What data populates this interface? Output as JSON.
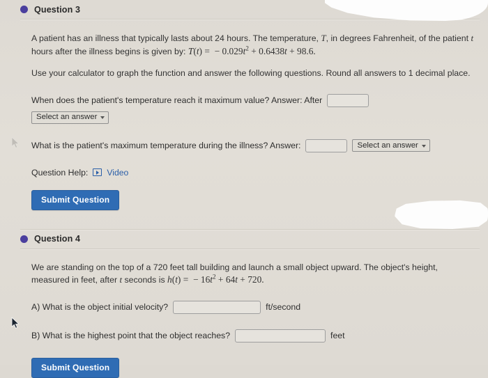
{
  "theme": {
    "page_background": "#dedad3",
    "bullet_color": "#4b3f9e",
    "button_color": "#2f6cb4",
    "link_color": "#2b5fa8"
  },
  "questions": [
    {
      "bullet_icon": "filled-circle-icon",
      "title": "Question 3",
      "paragraphs": [
        {
          "before": "A patient has an illness that typically lasts about 24 hours. The temperature, ",
          "var1": "T",
          "mid": ", in degrees Fahrenheit, of the patient ",
          "var2": "t",
          "after": " hours after the illness begins is given by: ",
          "formula": "T(t) = − 0.029t² + 0.6438t + 98.6."
        },
        {
          "text": "Use your calculator to graph the function and answer the following questions. Round all answers to 1 decimal place."
        }
      ],
      "prompts": [
        {
          "label": "When does the patient's temperature reach it maximum value?  Answer: After",
          "input_value": "",
          "input_placeholder": "",
          "select_label": "Select an answer",
          "select_below": true,
          "unit": ""
        },
        {
          "label": "What is the patient's maximum temperature during the illness?  Answer:",
          "input_value": "",
          "input_placeholder": "",
          "select_label": "Select an answer",
          "select_below": false,
          "unit": ""
        }
      ],
      "help_label": "Question Help:",
      "help_icon": "video-play-icon",
      "help_link": "Video",
      "submit_label": "Submit Question"
    },
    {
      "bullet_icon": "filled-circle-icon",
      "title": "Question 4",
      "paragraph": {
        "before": "We are standing on the top of a 720 feet tall building and launch a small object upward. The object's height, measured in feet, after ",
        "var": "t",
        "after": " seconds is ",
        "formula": "h(t) = − 16t² + 64t + 720."
      },
      "parts": [
        {
          "label": "A) What is the object initial velocity?",
          "input_value": "",
          "unit": "ft/second"
        },
        {
          "label": "B)  What is the highest point that the object reaches?",
          "input_value": "",
          "unit": "feet"
        }
      ],
      "submit_label": "Submit Question"
    }
  ]
}
